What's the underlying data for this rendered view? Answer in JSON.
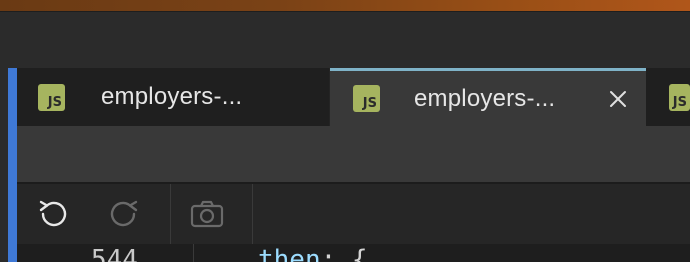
{
  "tabs": [
    {
      "icon_text": "JS",
      "label": "employers-...",
      "active": false
    },
    {
      "icon_text": "JS",
      "label": "employers-...",
      "active": true,
      "close_label": "✕"
    },
    {
      "icon_text": "JS",
      "label": "",
      "active": false
    }
  ],
  "toolbar": {
    "undo": "undo-icon",
    "redo": "redo-icon",
    "screenshot": "camera-icon"
  },
  "editor": {
    "line_number": "544",
    "code_key": "then",
    "code_rest": ": {"
  },
  "colors": {
    "accent_left": "#3f79d6",
    "active_tab_border": "#7fb3c8",
    "js_icon": "#a6b45f"
  }
}
